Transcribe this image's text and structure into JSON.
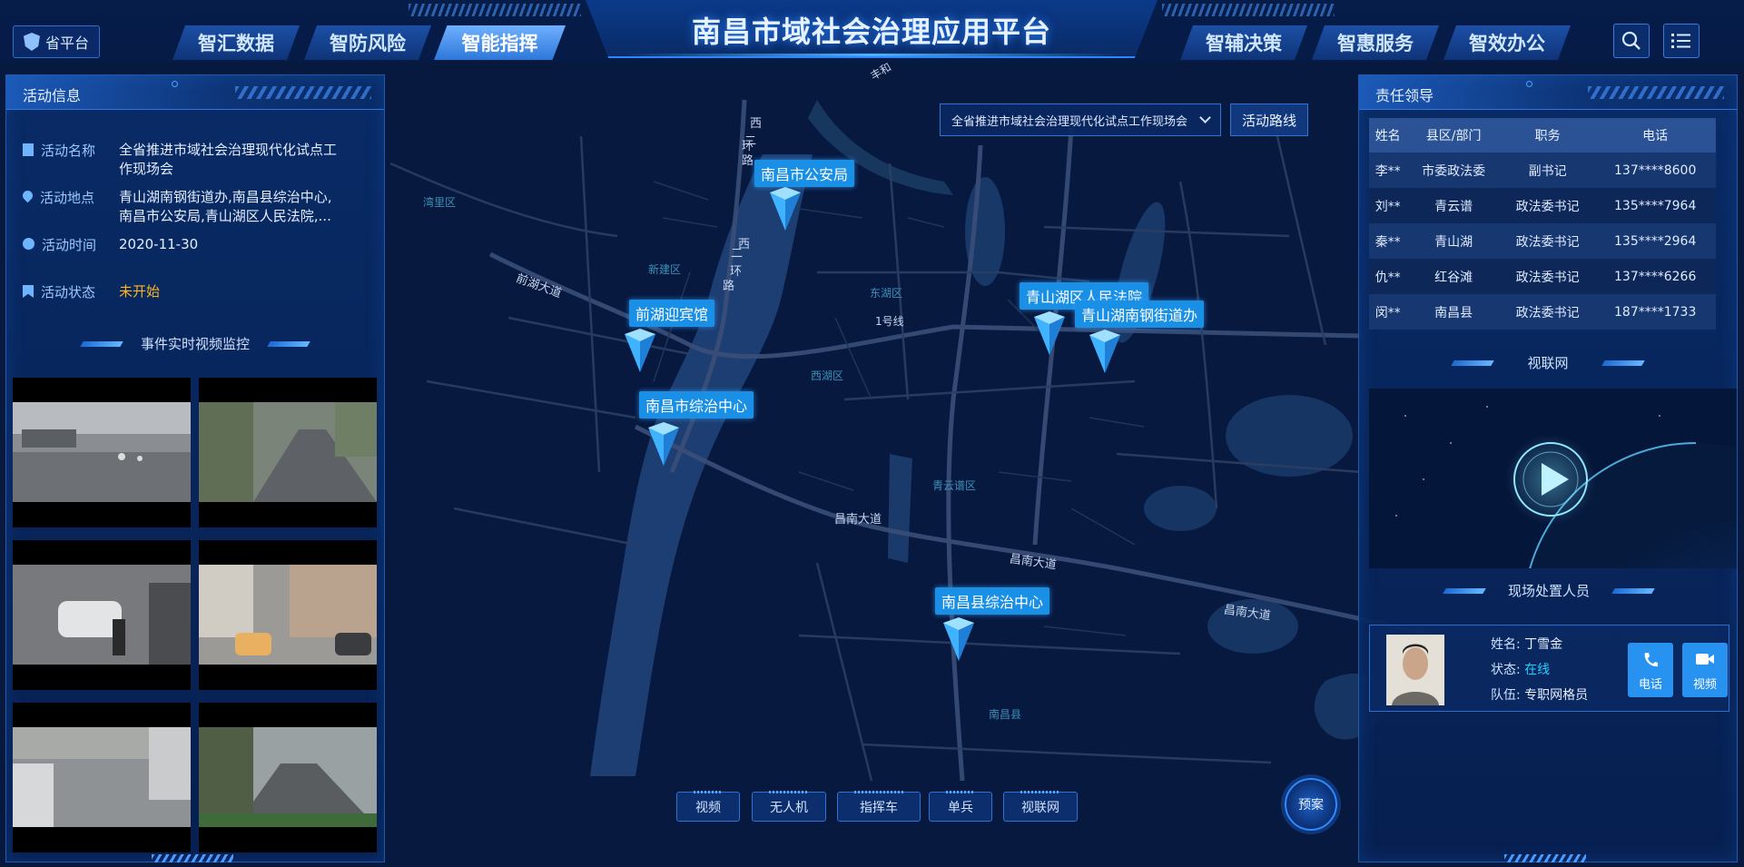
{
  "header": {
    "app_title": "南昌市域社会治理应用平台",
    "province_button": "省平台",
    "left_tabs": [
      {
        "label": "智汇数据",
        "active": false
      },
      {
        "label": "智防风险",
        "active": false
      },
      {
        "label": "智能指挥",
        "active": true
      }
    ],
    "right_tabs": [
      {
        "label": "智辅决策",
        "active": false
      },
      {
        "label": "智惠服务",
        "active": false
      },
      {
        "label": "智效办公",
        "active": false
      }
    ],
    "search_icon": "search-icon",
    "menu_icon": "list-menu-icon"
  },
  "left_panel": {
    "title": "活动信息",
    "fields": [
      {
        "key": "活动名称",
        "value": "全省推进市域社会治理现代化试点工作现场会",
        "icon": "document-icon"
      },
      {
        "key": "活动地点",
        "value": "青山湖南钢街道办,南昌县综治中心,南昌市公安局,青山湖区人民法院,...",
        "icon": "location-pin-icon"
      },
      {
        "key": "活动时间",
        "value": "2020-11-30",
        "icon": "clock-icon"
      },
      {
        "key": "活动状态",
        "value": "未开始",
        "icon": "bookmark-icon"
      }
    ],
    "video_section_title": "事件实时视频监控",
    "video_feeds": [
      {
        "scene": "rainy-intersection"
      },
      {
        "scene": "street-with-trees"
      },
      {
        "scene": "parking-lot-cars"
      },
      {
        "scene": "alley-shops"
      },
      {
        "scene": "parking-lot-wet"
      },
      {
        "scene": "campus-road"
      }
    ]
  },
  "map": {
    "event_select": "全省推进市域社会治理现代化试点工作现场会",
    "route_button": "活动路线",
    "markers": [
      {
        "label": "南昌市公安局"
      },
      {
        "label": "前湖迎宾馆"
      },
      {
        "label": "南昌市综治中心"
      },
      {
        "label": "青山湖区人民法院"
      },
      {
        "label": "青山湖南钢街道办"
      },
      {
        "label": "南昌县综治中心"
      }
    ],
    "district_labels": [
      "湾里区",
      "新建区",
      "东湖区",
      "西湖区",
      "青云谱区",
      "南昌县"
    ],
    "road_labels": {
      "west_ring_north": [
        "西",
        "二",
        "环",
        "路"
      ],
      "west_ring_south": [
        "西",
        "二",
        "环",
        "路"
      ],
      "qianhu": "前湖大道",
      "line1": "1号线",
      "changnan1": "昌南大道",
      "changnan2": "昌南大道",
      "changnan3": "昌南大道",
      "top_road": "丰和"
    },
    "bottom_buttons": [
      "视频",
      "无人机",
      "指挥车",
      "单兵",
      "视联网"
    ],
    "plan_button": "预案"
  },
  "right_panel": {
    "title": "责任领导",
    "table_headers": [
      "姓名",
      "县区/部门",
      "职务",
      "电话"
    ],
    "table_rows": [
      [
        "李**",
        "市委政法委",
        "副书记",
        "137****8600"
      ],
      [
        "刘**",
        "青云谱",
        "政法委书记",
        "135****7964"
      ],
      [
        "秦**",
        "青山湖",
        "政法委书记",
        "135****2964"
      ],
      [
        "仇**",
        "红谷滩",
        "政法委书记",
        "137****6266"
      ],
      [
        "闵**",
        "南昌县",
        "政法委书记",
        "187****1733"
      ]
    ],
    "video_net_title": "视联网",
    "onsite_title": "现场处置人员",
    "person": {
      "name_label": "姓名:",
      "name": "丁雪金",
      "status_label": "状态:",
      "status": "在线",
      "team_label": "队伍:",
      "team": "专职网格员"
    },
    "phone_button": "电话",
    "video_button": "视频"
  },
  "colors": {
    "background": "#061a44",
    "accent": "#2e86ff",
    "marker": "#1a8fe6",
    "status_pending": "#ffb522",
    "status_online": "#1fd3ff"
  }
}
